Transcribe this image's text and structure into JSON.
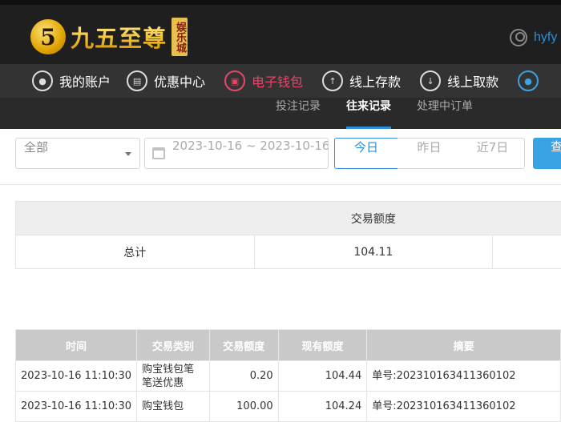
{
  "brand": {
    "logo_mark": "5",
    "name": "九五至尊",
    "sub": "娱乐城"
  },
  "user": {
    "name": "hyfy"
  },
  "nav": {
    "items": [
      {
        "label": "我的账户",
        "icon": "user-circle-icon"
      },
      {
        "label": "优惠中心",
        "icon": "gift-icon"
      },
      {
        "label": "电子钱包",
        "icon": "wallet-icon"
      },
      {
        "label": "线上存款",
        "icon": "deposit-icon"
      },
      {
        "label": "线上取款",
        "icon": "withdraw-icon"
      }
    ],
    "active_color": "#e8456b"
  },
  "subnav": {
    "tabs": [
      {
        "label": "投注记录"
      },
      {
        "label": "往来记录"
      },
      {
        "label": "处理中订单"
      }
    ]
  },
  "filter": {
    "type_select": "全部",
    "date_range": "2023-10-16 ~ 2023-10-16",
    "quick": {
      "today": "今日",
      "yesterday": "昨日",
      "last7": "近7日"
    },
    "search_label": "查"
  },
  "summary": {
    "header": "交易额度",
    "total_label": "总计",
    "total_value": "104.11"
  },
  "records": {
    "columns": [
      "时间",
      "交易类别",
      "交易额度",
      "现有额度",
      "摘要"
    ],
    "rows": [
      {
        "time": "2023-10-16 11:10:30",
        "type": "购宝钱包笔笔送优惠",
        "amount": "0.20",
        "balance": "104.44",
        "summary": "单号:202310163411360102"
      },
      {
        "time": "2023-10-16 11:10:30",
        "type": "购宝钱包",
        "amount": "100.00",
        "balance": "104.24",
        "summary": "单号:202310163411360102"
      }
    ]
  },
  "colors": {
    "accent": "#2e8fd8",
    "header_bg": "#1f1f1f",
    "nav_bg": "#333333"
  }
}
